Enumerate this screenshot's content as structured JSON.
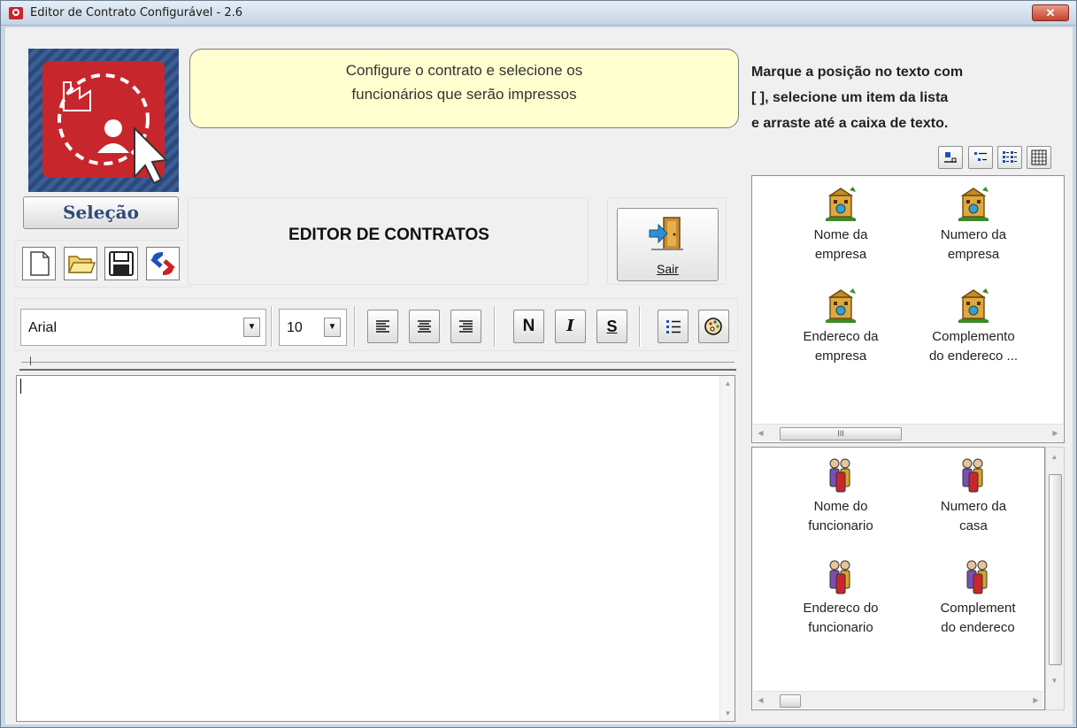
{
  "window": {
    "title": "Editor de Contrato Configurável - 2.6",
    "close_label": "✕"
  },
  "left": {
    "selection_button": "Seleção",
    "file_buttons": [
      "new-document",
      "open-folder",
      "save",
      "refresh"
    ]
  },
  "hint": {
    "line1": "Configure o contrato e selecione os",
    "line2": "funcionários que serão impressos"
  },
  "header": {
    "title": "EDITOR DE CONTRATOS",
    "exit_label": "Sair"
  },
  "toolbar": {
    "font": "Arial",
    "font_size": "10",
    "bold": "N",
    "italic": "I",
    "underline": "S"
  },
  "instructions": {
    "line1": "Marque a posição no texto com",
    "line2": "[ ], selecione um item da lista",
    "line3": "e arraste até a caixa de texto."
  },
  "company_fields": [
    {
      "line1": "Nome da",
      "line2": "empresa"
    },
    {
      "line1": "Numero da",
      "line2": "empresa"
    },
    {
      "line1": "Endereco da",
      "line2": "empresa"
    },
    {
      "line1": "Complemento",
      "line2": "do endereco ..."
    }
  ],
  "employee_fields": [
    {
      "line1": "Nome do",
      "line2": "funcionario"
    },
    {
      "line1": "Numero da",
      "line2": "casa"
    },
    {
      "line1": "Endereco do",
      "line2": "funcionario"
    },
    {
      "line1": "Complement",
      "line2": "do endereco"
    }
  ],
  "scroll_grip": "III",
  "colors": {
    "hint_bg": "#ffffd0",
    "selection_text": "#2f4a7a",
    "logo_red": "#c8262d"
  }
}
